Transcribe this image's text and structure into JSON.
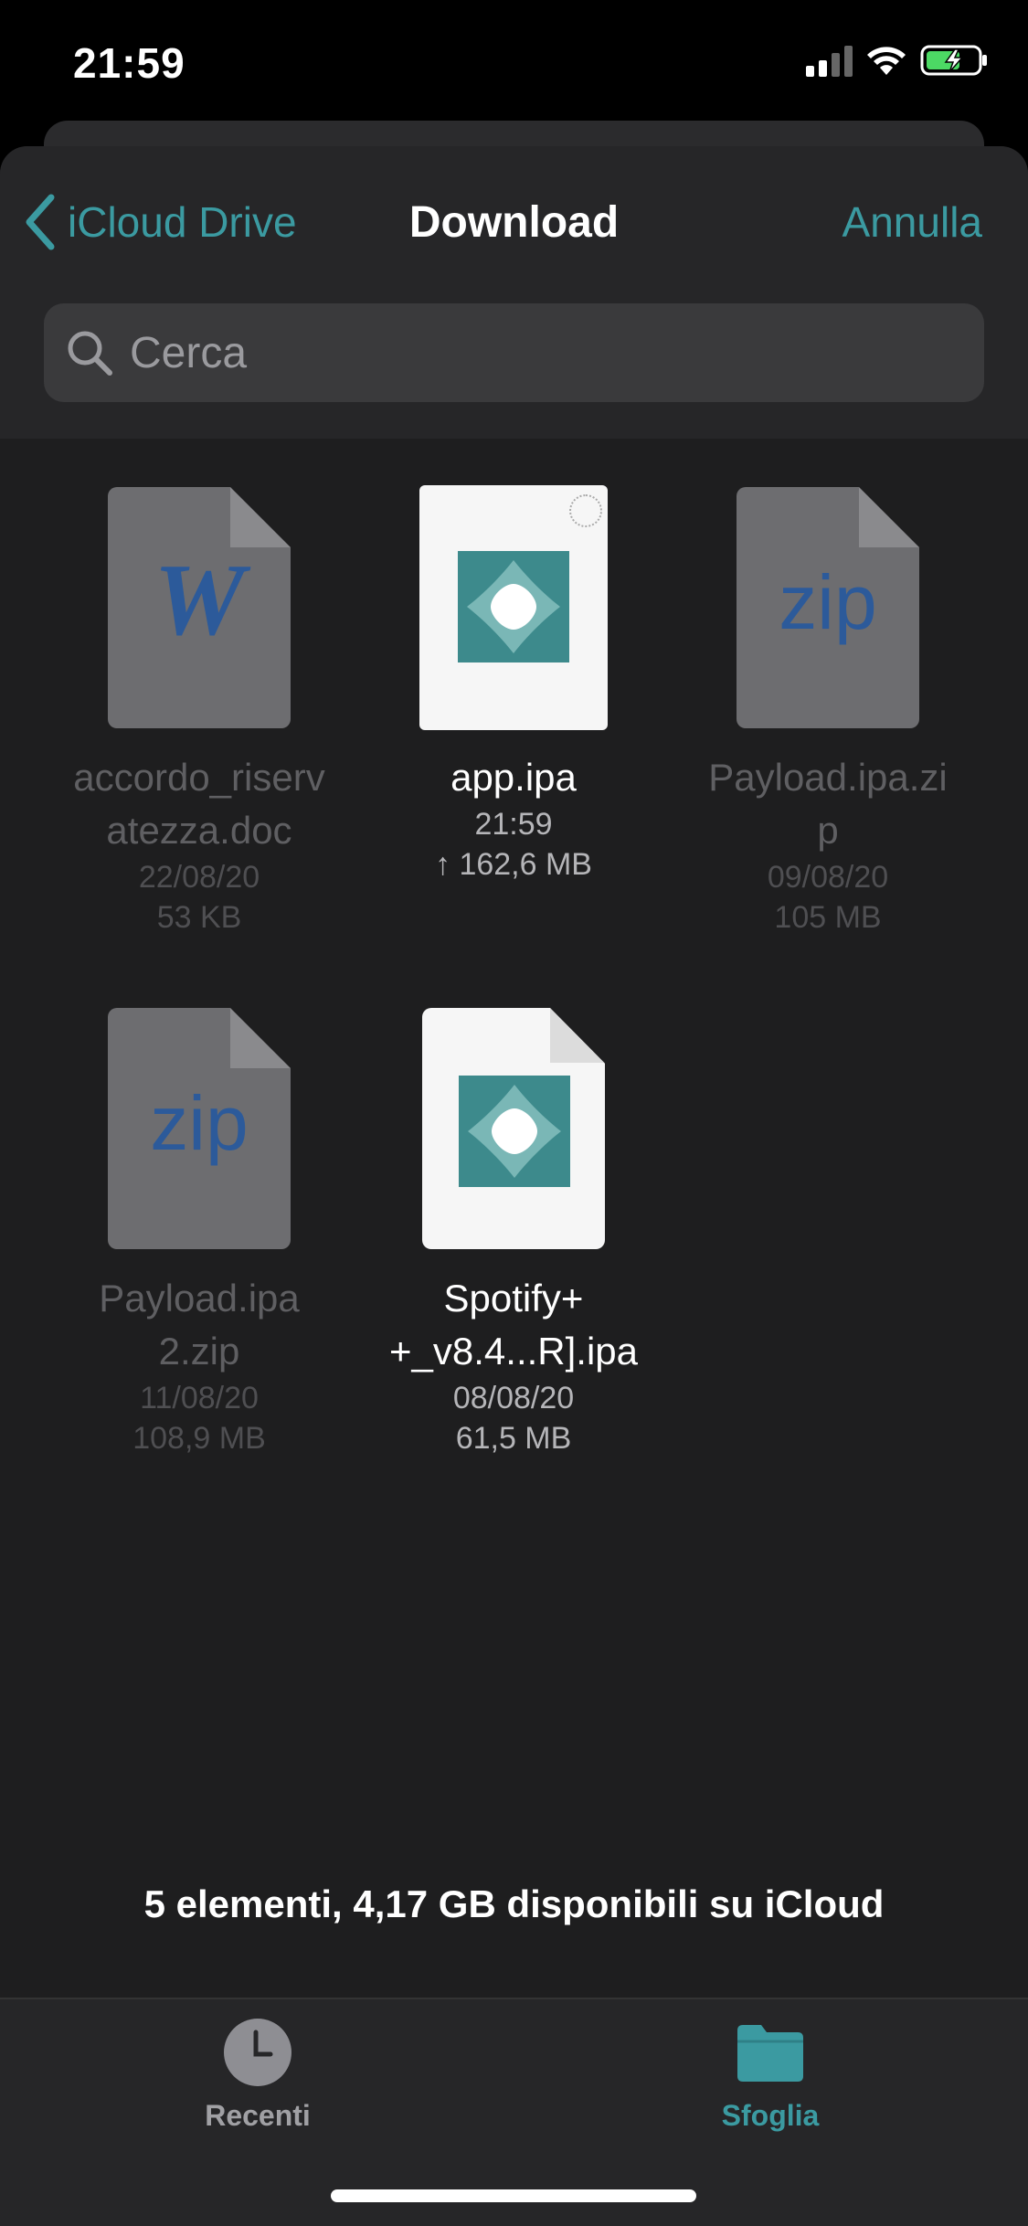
{
  "status_bar": {
    "time": "21:59"
  },
  "nav": {
    "back_label": "iCloud Drive",
    "title": "Download",
    "cancel_label": "Annulla"
  },
  "search": {
    "placeholder": "Cerca"
  },
  "files": [
    {
      "name_line1": "accordo_riserv",
      "name_line2": "atezza.doc",
      "date": "22/08/20",
      "size": "53 KB",
      "type": "word-doc-icon",
      "enabled": false
    },
    {
      "name_line1": "app.ipa",
      "name_line2": "",
      "date": "21:59",
      "size": "↑ 162,6 MB",
      "type": "ipa-app-icon",
      "enabled": true
    },
    {
      "name_line1": "Payload.ipa.zi",
      "name_line2": "p",
      "date": "09/08/20",
      "size": "105 MB",
      "type": "zip-icon",
      "enabled": false
    },
    {
      "name_line1": "Payload.ipa",
      "name_line2": "2.zip",
      "date": "11/08/20",
      "size": "108,9 MB",
      "type": "zip-icon",
      "enabled": false
    },
    {
      "name_line1": "Spotify+",
      "name_line2": "+_v8.4...R].ipa",
      "date": "08/08/20",
      "size": "61,5 MB",
      "type": "ipa-app-icon",
      "enabled": true
    }
  ],
  "zip_glyph": "zip",
  "word_glyph": "W",
  "footer": {
    "summary": "5 elementi, 4,17 GB disponibili su iCloud"
  },
  "tabs": {
    "recent_label": "Recenti",
    "browse_label": "Sfoglia"
  },
  "colors": {
    "accent": "#3b9aa1",
    "background": "#1e1e1f",
    "app_tile": "#3d8a8c"
  }
}
